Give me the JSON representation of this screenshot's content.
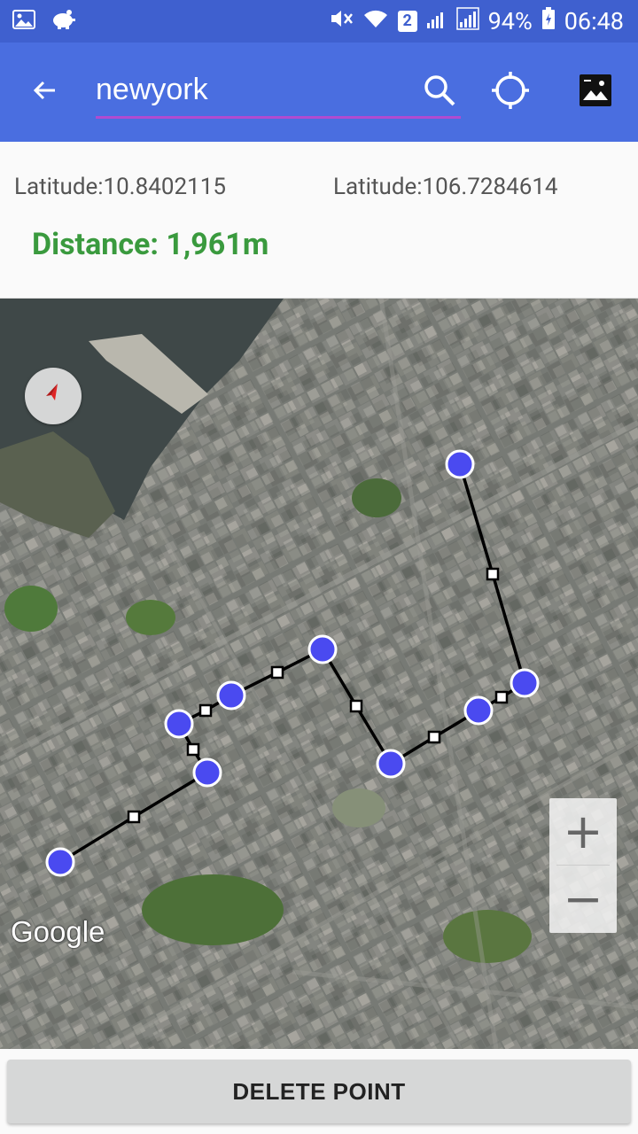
{
  "status_bar": {
    "sim_slot": "2",
    "battery": "94%",
    "time": "06:48",
    "icons_left": [
      "gallery-icon",
      "piggy-bank-icon"
    ],
    "icons_right": [
      "mute-icon",
      "wifi-icon",
      "sim-2-icon",
      "signal-icon",
      "signal-icon",
      "battery-icon"
    ]
  },
  "app_bar": {
    "search_value": "newyork",
    "icons": [
      "back-arrow-icon",
      "search-icon",
      "my-location-icon",
      "image-icon"
    ],
    "color": "#4a6ee0"
  },
  "info": {
    "latitude_label": "Latitude:10.8402115",
    "longitude_label": "Latitude:106.7284614",
    "distance_label": "Distance: 1,961m",
    "distance_color": "#3a9a3e"
  },
  "map": {
    "provider_logo": "Google",
    "zoom_in_label": "+",
    "zoom_out_label": "−",
    "marker_color": "#4a4af0"
  },
  "footer": {
    "delete_label": "DELETE POINT"
  }
}
